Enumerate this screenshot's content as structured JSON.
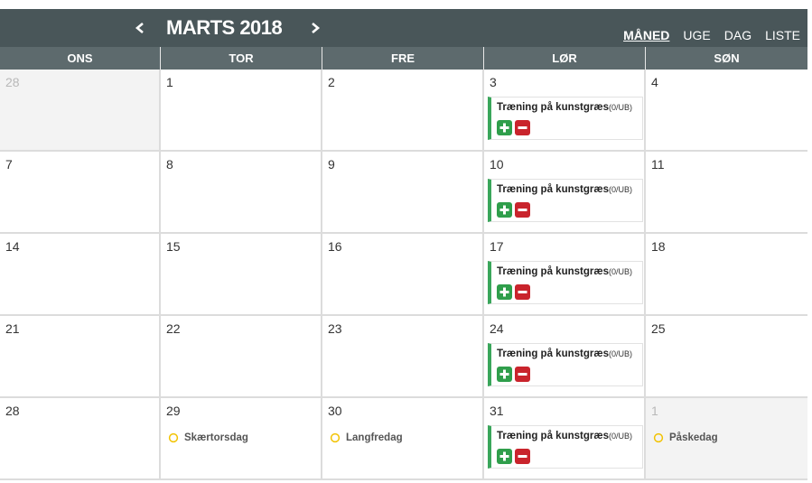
{
  "header": {
    "title": "MARTS 2018",
    "views": [
      {
        "label": "MÅNED",
        "active": true
      },
      {
        "label": "UGE",
        "active": false
      },
      {
        "label": "DAG",
        "active": false
      },
      {
        "label": "LISTE",
        "active": false
      }
    ]
  },
  "weekdays": [
    "ONS",
    "TOR",
    "FRE",
    "LØR",
    "SØN"
  ],
  "weeks": [
    [
      {
        "day": "28",
        "other": true
      },
      {
        "day": "1"
      },
      {
        "day": "2"
      },
      {
        "day": "3",
        "event": {
          "title": "Træning på kunstgræs",
          "sub": "(0/UB)"
        }
      },
      {
        "day": "4"
      }
    ],
    [
      {
        "day": "7"
      },
      {
        "day": "8"
      },
      {
        "day": "9"
      },
      {
        "day": "10",
        "event": {
          "title": "Træning på kunstgræs",
          "sub": "(0/UB)"
        }
      },
      {
        "day": "11"
      }
    ],
    [
      {
        "day": "14"
      },
      {
        "day": "15"
      },
      {
        "day": "16"
      },
      {
        "day": "17",
        "event": {
          "title": "Træning på kunstgræs",
          "sub": "(0/UB)"
        }
      },
      {
        "day": "18"
      }
    ],
    [
      {
        "day": "21"
      },
      {
        "day": "22"
      },
      {
        "day": "23"
      },
      {
        "day": "24",
        "event": {
          "title": "Træning på kunstgræs",
          "sub": "(0/UB)"
        }
      },
      {
        "day": "25"
      }
    ],
    [
      {
        "day": "28"
      },
      {
        "day": "29",
        "holiday": "Skærtorsdag"
      },
      {
        "day": "30",
        "holiday": "Langfredag"
      },
      {
        "day": "31",
        "event": {
          "title": "Træning på kunstgræs",
          "sub": "(0/UB)"
        }
      },
      {
        "day": "1",
        "other": true,
        "holiday": "Påskedag"
      }
    ]
  ],
  "colors": {
    "header_bg": "#495659",
    "dayhead_bg": "#5d6a6d",
    "event_accent": "#3aa65b",
    "plus_btn": "#2f9e4b",
    "minus_btn": "#c9242c",
    "holiday_icon": "#f2c200"
  }
}
